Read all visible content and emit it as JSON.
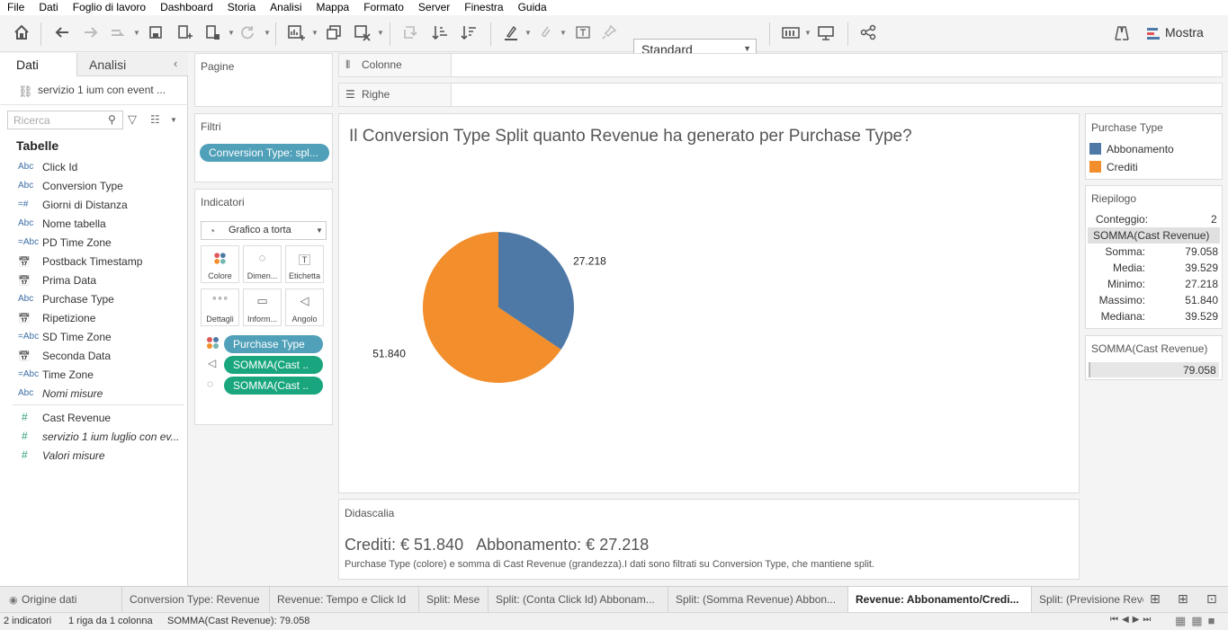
{
  "menu": [
    "File",
    "Dati",
    "Foglio di lavoro",
    "Dashboard",
    "Storia",
    "Analisi",
    "Mappa",
    "Formato",
    "Server",
    "Finestra",
    "Guida"
  ],
  "toolbar": {
    "fit_select": "Standard",
    "show_label": "Mostra"
  },
  "left_panel": {
    "tab_data": "Dati",
    "tab_analysis": "Analisi",
    "datasource": "servizio 1 ium con event ...",
    "search_placeholder": "Ricerca",
    "tables_heading": "Tabelle",
    "dimensions": [
      {
        "icon": "Abc",
        "label": "Click Id",
        "italic": false
      },
      {
        "icon": "Abc",
        "label": "Conversion Type",
        "italic": false
      },
      {
        "icon": "=#",
        "label": "Giorni di Distanza",
        "italic": false
      },
      {
        "icon": "Abc",
        "label": "Nome tabella",
        "italic": false
      },
      {
        "icon": "=Abc",
        "label": "PD Time Zone",
        "italic": false
      },
      {
        "icon": "date",
        "label": "Postback Timestamp",
        "italic": false
      },
      {
        "icon": "date",
        "label": "Prima Data",
        "italic": false
      },
      {
        "icon": "Abc",
        "label": "Purchase Type",
        "italic": false
      },
      {
        "icon": "date",
        "label": "Ripetizione",
        "italic": false
      },
      {
        "icon": "=Abc",
        "label": "SD Time Zone",
        "italic": false
      },
      {
        "icon": "date",
        "label": "Seconda Data",
        "italic": false
      },
      {
        "icon": "=Abc",
        "label": "Time Zone",
        "italic": false
      },
      {
        "icon": "Abc",
        "label": "Nomi misure",
        "italic": true
      }
    ],
    "measures": [
      {
        "icon": "#",
        "label": "Cast Revenue",
        "italic": false
      },
      {
        "icon": "#",
        "label": "servizio 1 ium luglio con ev...",
        "italic": true
      },
      {
        "icon": "#",
        "label": "Valori misure",
        "italic": true
      }
    ]
  },
  "shelves": {
    "pages": "Pagine",
    "filters": "Filtri",
    "filter_pill": "Conversion Type: spl...",
    "marks": "Indicatori",
    "mark_type": "Grafico a torta",
    "mark_buttons": [
      "Colore",
      "Dimen...",
      "Etichetta",
      "Dettagli",
      "Inform...",
      "Angolo"
    ],
    "mark_pills": [
      "Purchase Type",
      "SOMMA(Cast ..",
      "SOMMA(Cast .."
    ],
    "columns": "Colonne",
    "rows": "Righe"
  },
  "view": {
    "title": "Il Conversion Type Split quanto Revenue ha generato per Purchase Type?"
  },
  "chart_data": {
    "type": "pie",
    "title": "Il Conversion Type Split quanto Revenue ha generato per Purchase Type?",
    "series": [
      {
        "name": "Abbonamento",
        "value": 27.218,
        "label": "27.218",
        "color": "#4e79a7"
      },
      {
        "name": "Crediti",
        "value": 51.84,
        "label": "51.840",
        "color": "#f28e2b"
      }
    ],
    "legend_position": "right"
  },
  "legend": {
    "title": "Purchase Type",
    "items": [
      "Abbonamento",
      "Crediti"
    ]
  },
  "summary": {
    "title": "Riepilogo",
    "count_label": "Conteggio:",
    "count_value": "2",
    "measure_heading": "SOMMA(Cast Revenue)",
    "rows": [
      {
        "k": "Somma:",
        "v": "79.058"
      },
      {
        "k": "Media:",
        "v": "39.529"
      },
      {
        "k": "Minimo:",
        "v": "27.218"
      },
      {
        "k": "Massimo:",
        "v": "51.840"
      },
      {
        "k": "Mediana:",
        "v": "39.529"
      }
    ]
  },
  "size_legend": {
    "title": "SOMMA(Cast Revenue)",
    "value": "79.058"
  },
  "caption": {
    "title": "Didascalia",
    "headline": "Crediti: € 51.840   Abbonamento: € 27.218",
    "body": "Purchase Type (colore) e somma di Cast Revenue (grandezza).I dati sono filtrati su Conversion Type, che mantiene split."
  },
  "sheet_tabs": [
    {
      "label": "Origine dati",
      "active": false
    },
    {
      "label": "Conversion Type: Revenue",
      "active": false
    },
    {
      "label": "Revenue: Tempo e Click Id",
      "active": false
    },
    {
      "label": "Split: Mese",
      "active": false
    },
    {
      "label": "Split: (Conta Click Id) Abbonam...",
      "active": false
    },
    {
      "label": "Split: (Somma Revenue) Abbon...",
      "active": false
    },
    {
      "label": "Revenue: Abbonamento/Credi...",
      "active": true
    },
    {
      "label": "Split: (Previsione Rever",
      "active": false
    }
  ],
  "status": {
    "marks": "2 indicatori",
    "rows": "1 riga da 1 colonna",
    "sum": "SOMMA(Cast Revenue): 79.058"
  }
}
